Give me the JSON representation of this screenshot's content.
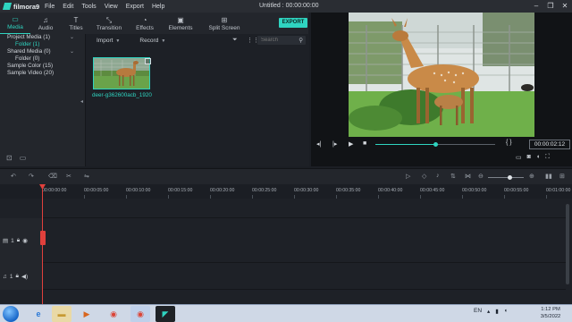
{
  "app": {
    "logo_text": "filmora9",
    "window_title": "Untitled : 00:00:00:00",
    "menu": [
      "File",
      "Edit",
      "Tools",
      "View",
      "Export",
      "Help"
    ],
    "window_controls": [
      "–",
      "❐",
      "✕"
    ]
  },
  "tabs": [
    {
      "label": "Media",
      "icon": "folder-icon",
      "active": true
    },
    {
      "label": "Audio",
      "icon": "music-note-icon"
    },
    {
      "label": "Titles",
      "icon": "text-icon"
    },
    {
      "label": "Transition",
      "icon": "transition-icon"
    },
    {
      "label": "Effects",
      "icon": "effects-icon"
    },
    {
      "label": "Elements",
      "icon": "elements-icon"
    },
    {
      "label": "Split Screen",
      "icon": "split-screen-icon"
    }
  ],
  "export_label": "EXPORT",
  "tree": {
    "project_media": "Project Media (1)",
    "project_folder": "Folder (1)",
    "shared_media": "Shared Media (0)",
    "shared_folder": "Folder (0)",
    "sample_color": "Sample Color (15)",
    "sample_video": "Sample Video (20)"
  },
  "media_toolbar": {
    "import_label": "Import",
    "record_label": "Record",
    "search_placeholder": "Search"
  },
  "media_items": [
    {
      "name": "deer-g362600acb_1920"
    }
  ],
  "player": {
    "timecode": "00:00:02:12",
    "progress": 0.5,
    "brackets": "{   }"
  },
  "timeline": {
    "zoom": 0.6,
    "ruler_labels": [
      "00:00:00:00",
      "00:00:05:00",
      "00:00:10:00",
      "00:00:15:00",
      "00:00:20:00",
      "00:00:25:00",
      "00:00:30:00",
      "00:00:35:00",
      "00:00:40:00",
      "00:00:45:00",
      "00:00:50:00",
      "00:00:55:00",
      "00:01:00:00"
    ],
    "video_track_label": "1",
    "audio_track_label": "1"
  },
  "taskbar": {
    "lang": "EN",
    "time": "1:12 PM",
    "date": "3/5/2022"
  },
  "colors": {
    "accent": "#2fd4c0",
    "playhead": "#e0403c"
  }
}
